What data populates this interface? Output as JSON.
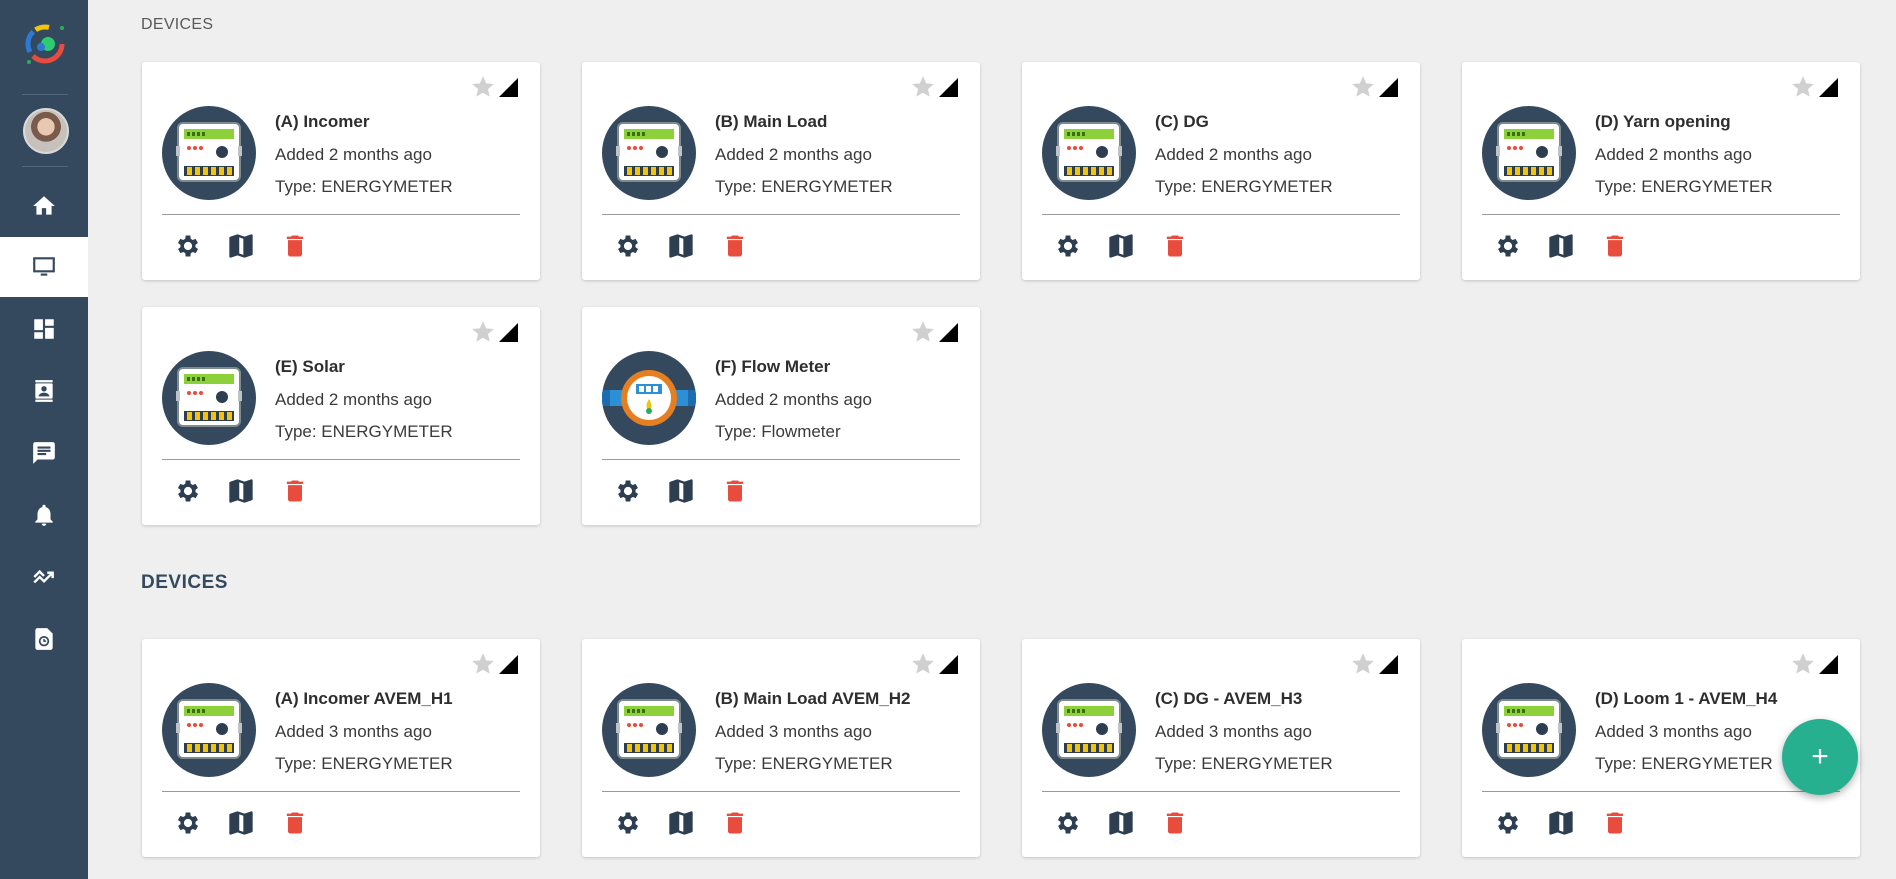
{
  "sections": {
    "top_label": "DEVICES",
    "bottom_label": "DEVICES"
  },
  "nav": [
    {
      "name": "home",
      "icon": "home-icon"
    },
    {
      "name": "devices",
      "icon": "monitor-icon",
      "active": true
    },
    {
      "name": "dashboard",
      "icon": "dashboard-icon"
    },
    {
      "name": "contacts",
      "icon": "contacts-icon"
    },
    {
      "name": "messages",
      "icon": "message-icon"
    },
    {
      "name": "notifications",
      "icon": "bell-icon"
    },
    {
      "name": "analytics",
      "icon": "trend-icon"
    },
    {
      "name": "history",
      "icon": "history-icon"
    }
  ],
  "cards": [
    {
      "name": "(A) Incomer",
      "added": "Added 2 months ago",
      "type": "Type: ENERGYMETER",
      "icon": "energy-meter-icon"
    },
    {
      "name": "(B) Main Load",
      "added": "Added 2 months ago",
      "type": "Type: ENERGYMETER",
      "icon": "energy-meter-icon"
    },
    {
      "name": "(C) DG",
      "added": "Added 2 months ago",
      "type": "Type: ENERGYMETER",
      "icon": "energy-meter-icon"
    },
    {
      "name": "(D) Yarn opening",
      "added": "Added 2 months ago",
      "type": "Type: ENERGYMETER",
      "icon": "energy-meter-icon"
    },
    {
      "name": "(E) Solar",
      "added": "Added 2 months ago",
      "type": "Type: ENERGYMETER",
      "icon": "energy-meter-icon"
    },
    {
      "name": "(F) Flow Meter",
      "added": "Added 2 months ago",
      "type": "Type: Flowmeter",
      "icon": "flow-meter-icon"
    },
    {
      "name": "(A) Incomer AVEM_H1",
      "added": "Added 3 months ago",
      "type": "Type: ENERGYMETER",
      "icon": "energy-meter-icon"
    },
    {
      "name": "(B) Main Load AVEM_H2",
      "added": "Added 3 months ago",
      "type": "Type: ENERGYMETER",
      "icon": "energy-meter-icon"
    },
    {
      "name": "(C) DG - AVEM_H3",
      "added": "Added 3 months ago",
      "type": "Type: ENERGYMETER",
      "icon": "energy-meter-icon"
    },
    {
      "name": "(D) Loom 1 - AVEM_H4",
      "added": "Added 3 months ago",
      "type": "Type: ENERGYMETER",
      "icon": "energy-meter-icon"
    }
  ],
  "fab": {
    "label": "+"
  },
  "colors": {
    "sidebar": "#34495e",
    "accent": "#26b08f",
    "delete": "#e74c3c",
    "icon_dark": "#2c3e50"
  }
}
